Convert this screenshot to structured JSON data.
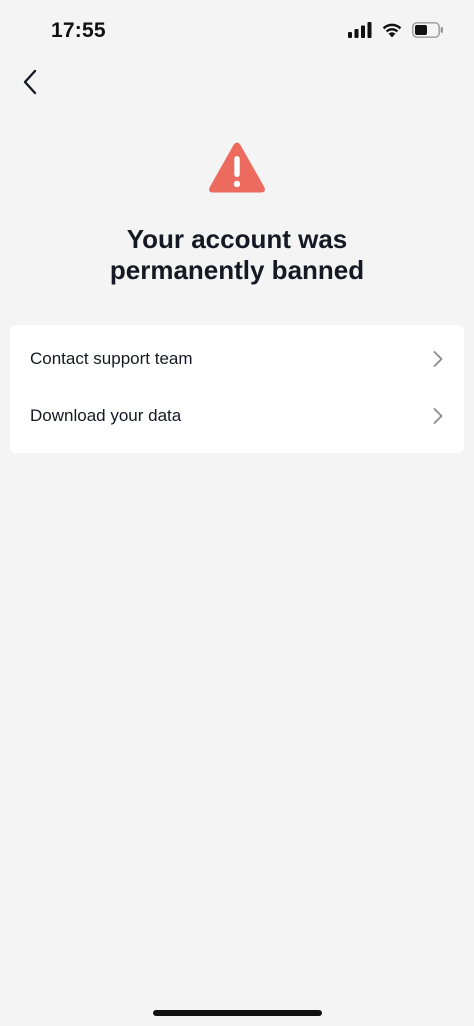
{
  "status_bar": {
    "time": "17:55",
    "icons": [
      "cellular-signal-icon",
      "wifi-icon",
      "battery-icon"
    ]
  },
  "nav": {
    "back_icon": "chevron-left-icon"
  },
  "alert": {
    "icon": "warning-triangle-icon",
    "icon_color": "#ec6a5e",
    "title_line1": "Your account was",
    "title_line2": "permanently banned"
  },
  "options": [
    {
      "label": "Contact support team",
      "icon": "chevron-right-icon"
    },
    {
      "label": "Download your data",
      "icon": "chevron-right-icon"
    }
  ],
  "colors": {
    "background": "#f4f4f4",
    "card": "#ffffff",
    "text": "#161823",
    "chevron": "#8a8b91"
  }
}
